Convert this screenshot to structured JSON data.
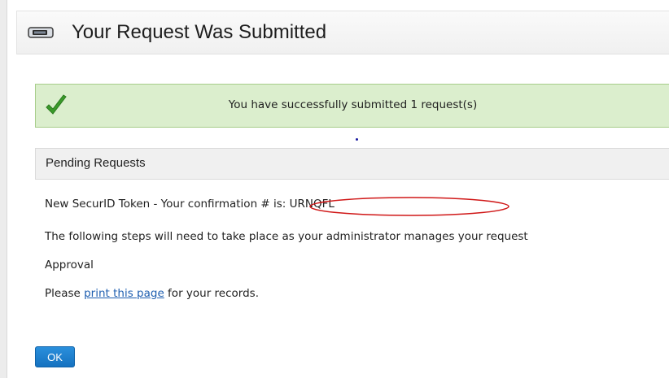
{
  "header": {
    "title": "Your Request Was Submitted",
    "icon": "token-device-icon"
  },
  "banner": {
    "message": "You have successfully submitted 1 request(s)",
    "icon": "checkmark-icon",
    "background": "#dbeecd",
    "border": "#a7cd8a",
    "check_color": "#3a9a2a"
  },
  "section": {
    "title": "Pending Requests"
  },
  "content": {
    "confirmation_line": "New SecurID Token - Your confirmation # is: URNQFL",
    "steps_line": "The following steps will need to take place as your administrator manages your request",
    "step_item": "Approval",
    "print_prefix": "Please ",
    "print_link": "print this page",
    "print_suffix": " for your records."
  },
  "annotation": {
    "color": "#d01818"
  },
  "actions": {
    "ok_label": "OK",
    "ok_color": "#1e7fd0"
  }
}
